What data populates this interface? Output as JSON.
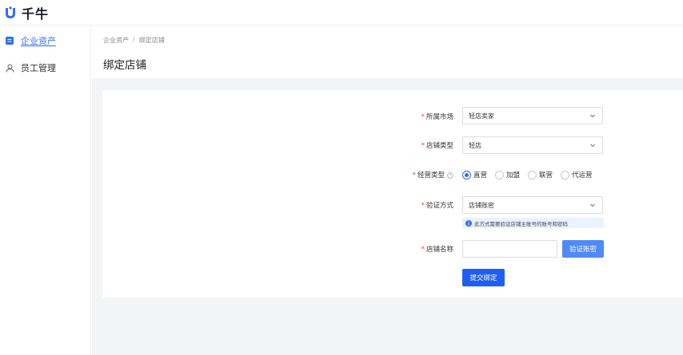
{
  "app": {
    "brand": "千牛",
    "brand_color": "#2f6df6"
  },
  "sidebar": {
    "items": [
      {
        "label": "企业资产",
        "icon": "list-square-icon",
        "active": true
      },
      {
        "label": "员工管理",
        "icon": "user-icon",
        "active": false
      }
    ]
  },
  "header": {
    "breadcrumb": [
      "企业资产",
      "绑定店铺"
    ],
    "breadcrumb_sep": "/",
    "title": "绑定店铺"
  },
  "form": {
    "market": {
      "label": "所属市场",
      "value": "轻店卖家"
    },
    "shop_type": {
      "label": "店铺类型",
      "value": "轻店"
    },
    "biz_type": {
      "label": "经营类型",
      "options": [
        "直营",
        "加盟",
        "联营",
        "代运营"
      ],
      "selected": "直营"
    },
    "verify_method": {
      "label": "验证方式",
      "value": "店铺账密"
    },
    "notice": "此方式需要验证店铺主账号的账号和密码",
    "shop_name": {
      "label": "店铺名称",
      "value": "",
      "placeholder": ""
    },
    "verify_button": "验证账密",
    "submit_button": "提交绑定",
    "required_mark": "*"
  }
}
